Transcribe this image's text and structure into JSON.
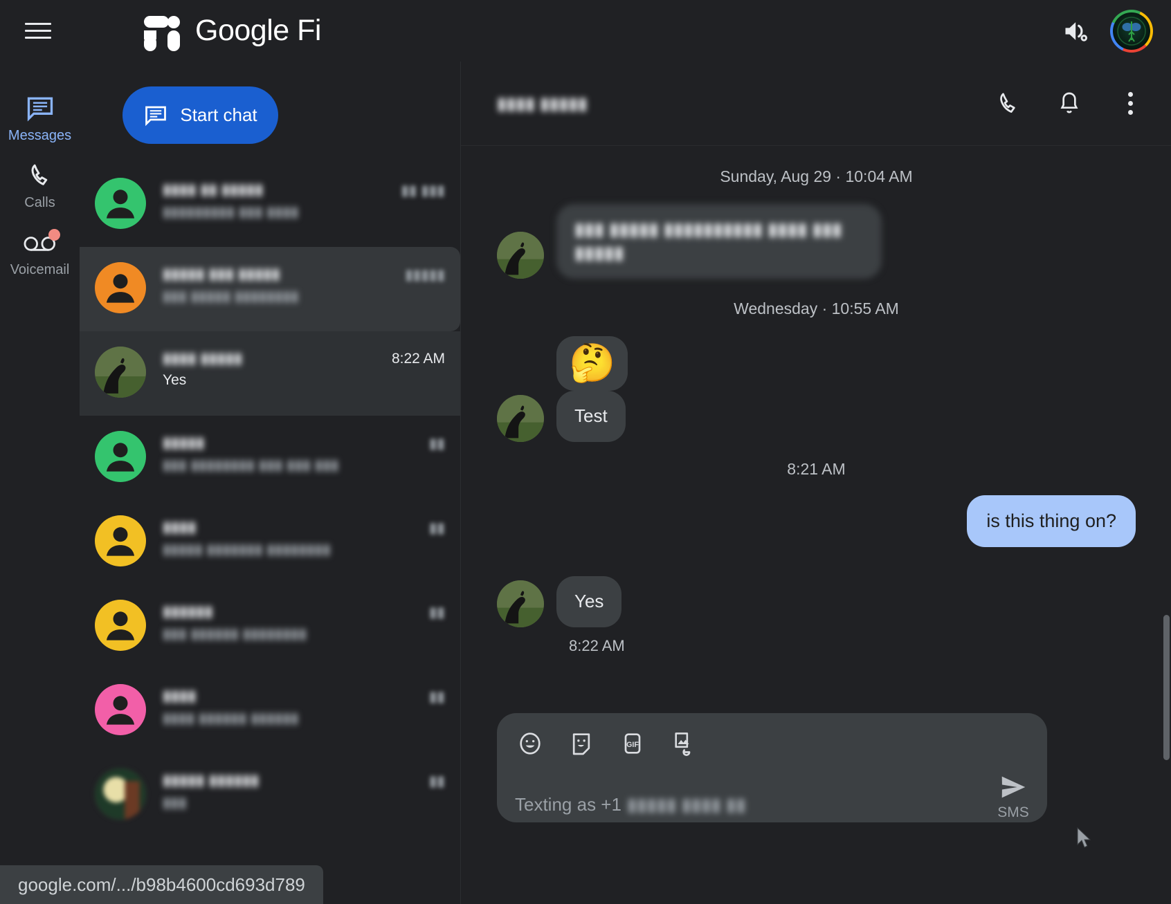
{
  "header": {
    "menu_icon": "hamburger-menu-icon",
    "brand": "Google Fi",
    "sound_icon": "sound-settings-icon",
    "avatar_icon": "user-avatar"
  },
  "rail": {
    "items": [
      {
        "label": "Messages",
        "icon": "message-icon",
        "active": true,
        "badge": false
      },
      {
        "label": "Calls",
        "icon": "phone-icon",
        "active": false,
        "badge": false
      },
      {
        "label": "Voicemail",
        "icon": "voicemail-icon",
        "active": false,
        "badge": true
      }
    ]
  },
  "list": {
    "start_chat_label": "Start chat",
    "conversations": [
      {
        "name": "▮▮▮▮ ▮▮ ▮▮▮▮▮",
        "snippet": "▮▮▮▮▮▮▮▮▮ ▮▮▮ ▮▮▮▮",
        "time": "▮▮ ▮▮▮",
        "avatar_color": "#34c46e",
        "avatar_type": "person",
        "state": "normal",
        "redacted": true
      },
      {
        "name": "▮▮▮▮▮ ▮▮▮ ▮▮▮▮▮",
        "snippet": "▮▮▮ ▮▮▮▮▮ ▮▮▮▮▮▮▮▮",
        "time": "▮▮▮▮▮",
        "avatar_color": "#f08a24",
        "avatar_type": "person",
        "state": "hover",
        "redacted": true
      },
      {
        "name": "▮▮▮▮ ▮▮▮▮▮",
        "snippet": "Yes",
        "time": "8:22 AM",
        "avatar_color": "#3b4a33",
        "avatar_type": "photo",
        "state": "selected",
        "redacted": true
      },
      {
        "name": "▮▮▮▮▮",
        "snippet": "▮▮▮ ▮▮▮▮▮▮▮▮ ▮▮▮ ▮▮▮ ▮▮▮",
        "time": "▮▮",
        "avatar_color": "#34c46e",
        "avatar_type": "person",
        "state": "normal",
        "redacted": true
      },
      {
        "name": "▮▮▮▮",
        "snippet": "▮▮▮▮▮ ▮▮▮▮▮▮▮ ▮▮▮▮▮▮▮▮",
        "time": "▮▮",
        "avatar_color": "#f2c024",
        "avatar_type": "person",
        "state": "normal",
        "redacted": true
      },
      {
        "name": "▮▮▮▮▮▮",
        "snippet": "▮▮▮ ▮▮▮▮▮▮ ▮▮▮▮▮▮▮▮",
        "time": "▮▮",
        "avatar_color": "#f2c024",
        "avatar_type": "person",
        "state": "normal",
        "redacted": true
      },
      {
        "name": "▮▮▮▮",
        "snippet": "▮▮▮▮ ▮▮▮▮▮▮ ▮▮▮▮▮▮",
        "time": "▮▮",
        "avatar_color": "#f25fa8",
        "avatar_type": "person",
        "state": "normal",
        "redacted": true
      },
      {
        "name": "▮▮▮▮▮ ▮▮▮▮▮▮",
        "snippet": "▮▮▮",
        "time": "▮▮",
        "avatar_color": "#d8c89a",
        "avatar_type": "photo",
        "state": "normal",
        "redacted": true
      }
    ]
  },
  "chat": {
    "contact_name": "▮▮▮▮ ▮▮▮▮▮",
    "call_icon": "phone-icon",
    "notify_icon": "bell-icon",
    "more_icon": "kebab-menu-icon",
    "messages": [
      {
        "kind": "daystamp",
        "text": "Sunday, Aug 29 · 10:04 AM"
      },
      {
        "kind": "in",
        "text": "▮▮▮ ▮▮▮▮▮ ▮▮▮▮▮▮▮▮▮▮ ▮▮▮▮ ▮▮▮ ▮▮▮▮▮",
        "redacted": true,
        "avatar": true
      },
      {
        "kind": "daystamp",
        "text": "Wednesday · 10:55 AM"
      },
      {
        "kind": "in-emoji",
        "text": "🤔",
        "avatar": false
      },
      {
        "kind": "in",
        "text": "Test",
        "redacted": false,
        "avatar": true
      },
      {
        "kind": "timestamp",
        "text": "8:21 AM"
      },
      {
        "kind": "out",
        "text": "is this thing on?"
      },
      {
        "kind": "in",
        "text": "Yes",
        "redacted": false,
        "avatar": true
      },
      {
        "kind": "msg-time",
        "text": "8:22 AM"
      }
    ]
  },
  "compose": {
    "emoji_icon": "emoji-icon",
    "sticker_icon": "sticker-icon",
    "gif_icon": "gif-icon",
    "attach_icon": "image-attach-icon",
    "placeholder_prefix": "Texting as +1",
    "placeholder_number": "▮▮▮▮▮ ▮▮▮▮ ▮▮",
    "send_icon": "send-icon",
    "send_label": "SMS"
  },
  "status": {
    "url": "google.com/.../b98b4600cd693d789"
  },
  "colors": {
    "accent_blue": "#1a5fd0",
    "active_nav": "#8ab4f8",
    "sent_bubble": "#a8c7fa",
    "received_bubble": "#3c4043",
    "page_bg": "#202124"
  }
}
